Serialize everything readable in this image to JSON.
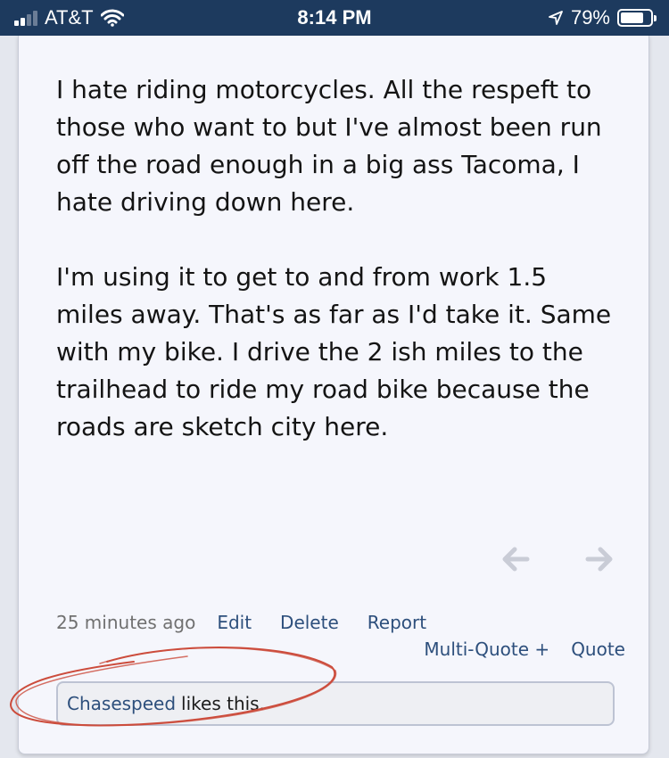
{
  "status_bar": {
    "carrier": "AT&T",
    "time": "8:14 PM",
    "battery_percent": "79%",
    "battery_level": 0.79,
    "signal_bars_filled": 2,
    "signal_bars_total": 4
  },
  "post": {
    "paragraphs": [
      "I hate riding motorcycles. All the respeft to those who want to but I've almost been run off the road enough in a big ass Tacoma, I hate driving down here.",
      "I'm using it to get to and from work 1.5 miles away. That's as far as I'd take it. Same with my bike. I drive the 2 ish miles to the trailhead to ride my road bike because the roads are sketch city here."
    ],
    "timestamp": "25 minutes ago",
    "actions": {
      "edit": "Edit",
      "delete": "Delete",
      "report": "Report",
      "multi_quote": "Multi-Quote +",
      "quote": "Quote"
    },
    "likes": {
      "user": "Chasespeed",
      "suffix": "likes this."
    }
  },
  "icons": {
    "prev": "arrow-left-icon",
    "next": "arrow-right-icon",
    "wifi": "wifi-icon",
    "location": "location-arrow-icon",
    "battery": "battery-icon",
    "signal": "cellular-signal-icon"
  },
  "colors": {
    "status_bar_bg": "#1d3a5e",
    "card_bg": "#f5f6fc",
    "link": "#2d4f7c",
    "annotation_stroke": "#cc4c3c",
    "arrow": "#c9ccd6"
  }
}
